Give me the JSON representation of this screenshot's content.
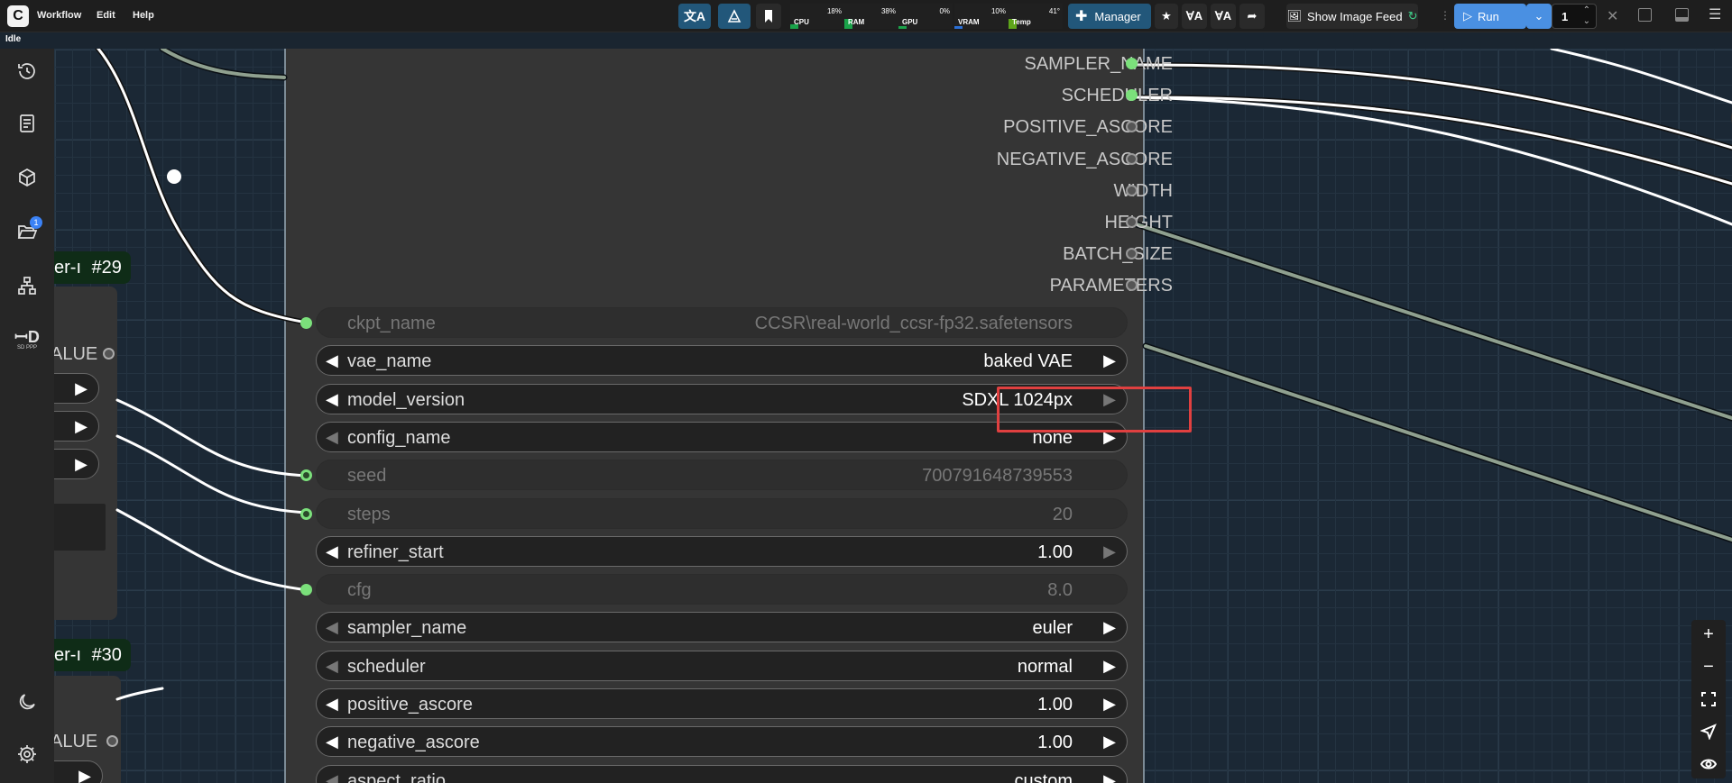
{
  "app": {
    "logo_letter": "C",
    "status": "Idle",
    "menu": [
      "Workflow",
      "Edit",
      "Help"
    ]
  },
  "toolbar": {
    "manager_label": "Manager",
    "show_image_feed_label": "Show Image Feed",
    "run_label": "Run",
    "queue_count": "1",
    "monitors": [
      {
        "label": "CPU",
        "value": "18%",
        "fill": 0.18,
        "color": "#1aa34a"
      },
      {
        "label": "RAM",
        "value": "38%",
        "fill": 0.38,
        "color": "#1aa34a"
      },
      {
        "label": "GPU",
        "value": "0%",
        "fill": 0.0,
        "color": "#1aa34a"
      },
      {
        "label": "VRAM",
        "value": "10%",
        "fill": 0.1,
        "color": "#2a6fd6"
      },
      {
        "label": "Temp",
        "value": "41°",
        "fill": 0.41,
        "color": "#5ea51a"
      }
    ]
  },
  "sidebar": {
    "items": [
      "history-icon",
      "queue-icon",
      "models-icon",
      "workflows-icon",
      "node-library-icon",
      "sd-ppp-icon",
      "theme-icon",
      "settings-icon"
    ],
    "workflows_badge": "1",
    "sdppp_label": "SD PPP"
  },
  "side_nodes": {
    "top": {
      "title_fragment": "er-ı",
      "id": "#29",
      "output_fragment": "ALUE"
    },
    "bottom": {
      "title_fragment": "er-ı",
      "id": "#30",
      "output_fragment": "ALUE"
    }
  },
  "node": {
    "outputs": [
      "SAMPLER_NAME",
      "SCHEDULER",
      "POSITIVE_ASCORE",
      "NEGATIVE_ASCORE",
      "WIDTH",
      "HEIGHT",
      "BATCH_SIZE",
      "PARAMETERS"
    ],
    "widgets": [
      {
        "name": "ckpt_name",
        "value": "CCSR\\real-world_ccsr-fp32.safetensors",
        "disabled": true,
        "input": "green"
      },
      {
        "name": "vae_name",
        "value": "baked VAE",
        "disabled": false,
        "input": null
      },
      {
        "name": "model_version",
        "value": "SDXL 1024px",
        "disabled": false,
        "input": null,
        "right_dim": true
      },
      {
        "name": "config_name",
        "value": "none",
        "disabled": false,
        "input": null,
        "left_dim": true
      },
      {
        "name": "seed",
        "value": "700791648739553",
        "disabled": true,
        "input": "hollow"
      },
      {
        "name": "steps",
        "value": "20",
        "disabled": true,
        "input": "hollow"
      },
      {
        "name": "refiner_start",
        "value": "1.00",
        "disabled": false,
        "input": null,
        "right_dim": true
      },
      {
        "name": "cfg",
        "value": "8.0",
        "disabled": true,
        "input": "green"
      },
      {
        "name": "sampler_name",
        "value": "euler",
        "disabled": false,
        "input": null,
        "left_dim": true
      },
      {
        "name": "scheduler",
        "value": "normal",
        "disabled": false,
        "input": null,
        "left_dim": true
      },
      {
        "name": "positive_ascore",
        "value": "1.00",
        "disabled": false,
        "input": null
      },
      {
        "name": "negative_ascore",
        "value": "1.00",
        "disabled": false,
        "input": null
      },
      {
        "name": "aspect_ratio",
        "value": "custom",
        "disabled": false,
        "input": null,
        "left_dim": true
      }
    ]
  }
}
